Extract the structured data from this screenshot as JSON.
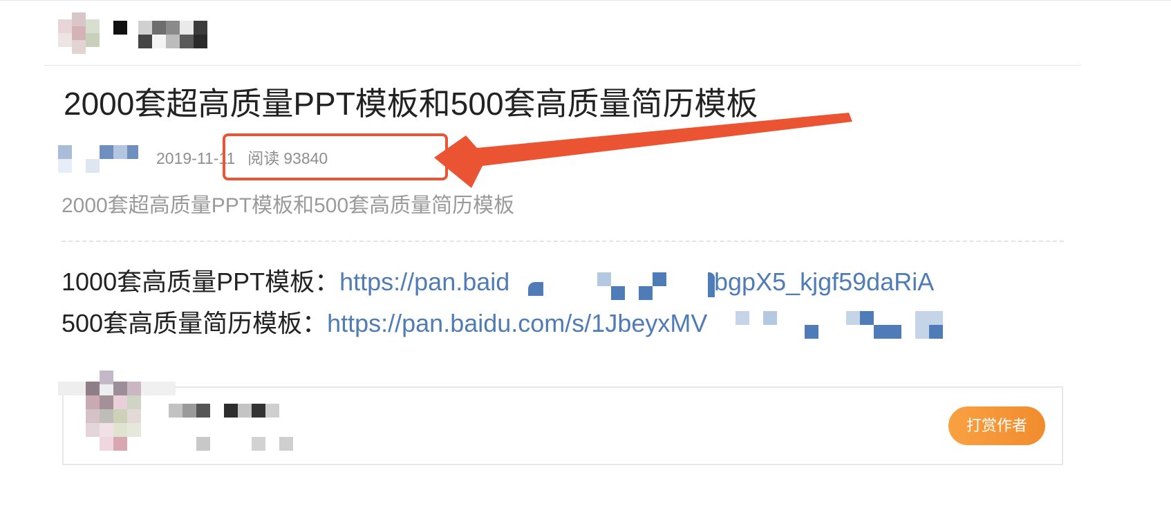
{
  "article": {
    "title": "2000套超高质量PPT模板和500套高质量简历模板",
    "summary": "2000套超高质量PPT模板和500套高质量简历模板"
  },
  "meta": {
    "date": "2019-11-11",
    "read_label": "阅读",
    "read_count": "93840"
  },
  "links": {
    "ppt_label": "1000套高质量PPT模板：",
    "ppt_url_start": "https://pan.baid",
    "ppt_url_end": "bgpX5_kjgf59daRiA",
    "resume_label": "500套高质量简历模板：",
    "resume_url_start": "https://pan.baidu.com/s/1JbeyxMV"
  },
  "author_card": {
    "reward_button": "打赏作者"
  },
  "colors": {
    "annotation": "#ea5433",
    "link": "#4f7bb6",
    "button": "#f39534"
  },
  "icons": {
    "header_avatar": "avatar-icon",
    "arrow": "arrow-icon"
  }
}
